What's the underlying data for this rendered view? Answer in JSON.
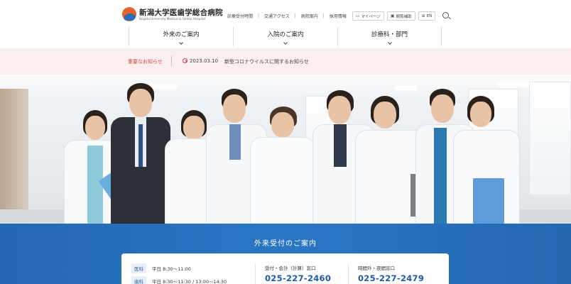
{
  "header": {
    "logo_title": "新潟大学医歯学総合病院",
    "logo_subtitle": "Niigata University Medical & Dental Hospital",
    "util_links": [
      "診療受付時間",
      "交通アクセス",
      "病院案内",
      "採用情報"
    ],
    "mypage_label": "マイページ",
    "viewing_support_label": "閲覧補助",
    "lang_label": "EN"
  },
  "gnav": {
    "items": [
      "外来のご案内",
      "入院のご案内",
      "診療科・部門"
    ]
  },
  "news": {
    "label": "重要なお知らせ",
    "date": "2023.03.10",
    "title": "新型コロナウイルスに関するお知らせ"
  },
  "outpatient": {
    "title": "外来受付のご案内",
    "rows": [
      {
        "dept": "医科",
        "hours": "平日  8:30～11:00"
      },
      {
        "dept": "歯科",
        "hours": "平日  8:30～11:30 / 13:00～14:30"
      }
    ],
    "reception": {
      "label": "受付・会計（計算）窓口",
      "tel": "025-227-2460"
    },
    "night": {
      "label": "時間外・夜間窓口",
      "tel": "025-227-2479"
    }
  },
  "colors": {
    "accent_blue": "#2a6db8",
    "news_red": "#c94646",
    "logo_orange": "#e8622c"
  }
}
